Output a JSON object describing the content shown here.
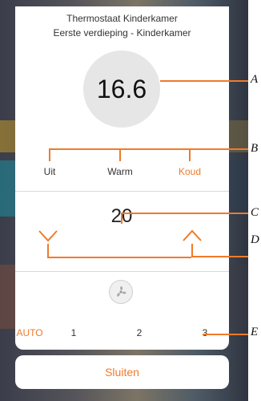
{
  "dialog": {
    "title": "Thermostaat Kinderkamer",
    "subtitle": "Eerste verdieping - Kinderkamer",
    "current_temperature": "16.6"
  },
  "modes": {
    "items": [
      {
        "label": "Uit",
        "active": false
      },
      {
        "label": "Warm",
        "active": false
      },
      {
        "label": "Koud",
        "active": true
      }
    ]
  },
  "setpoint": {
    "value": "20",
    "decrease_icon": "chevron-down-icon",
    "increase_icon": "chevron-up-icon"
  },
  "fan": {
    "icon": "fan-icon",
    "speeds": [
      {
        "label": "AUTO",
        "active": true
      },
      {
        "label": "1",
        "active": false
      },
      {
        "label": "2",
        "active": false
      },
      {
        "label": "3",
        "active": false
      }
    ]
  },
  "footer": {
    "close_label": "Sluiten"
  },
  "callouts": [
    "A",
    "B",
    "C",
    "D",
    "E"
  ],
  "colors": {
    "accent": "#f07a2a",
    "temperature_circle": "#e6e6e6"
  }
}
